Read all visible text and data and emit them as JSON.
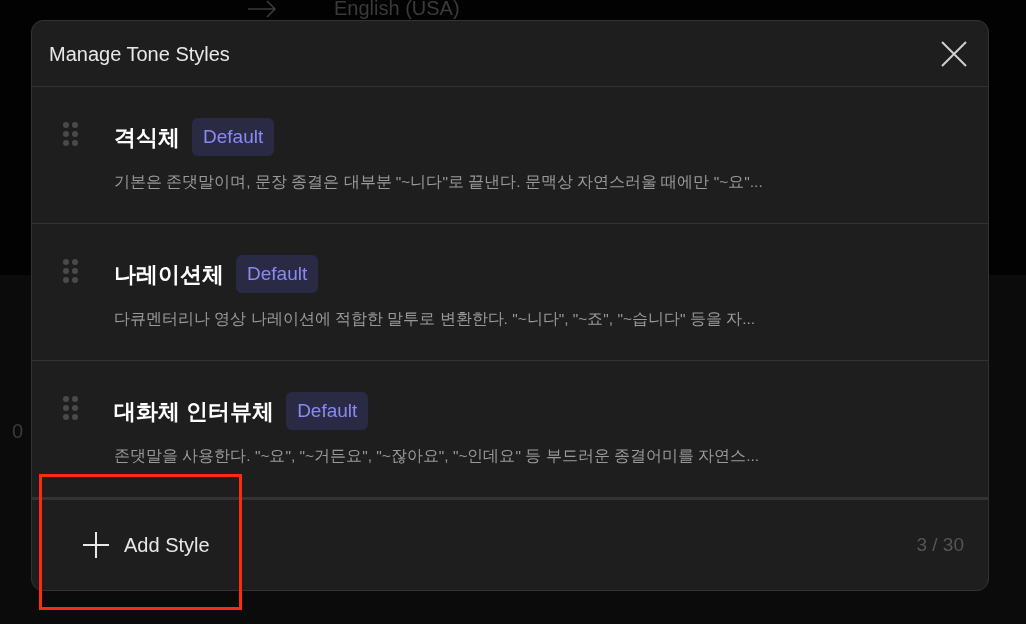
{
  "background": {
    "target_language": "English (USA)",
    "axis_label": "0"
  },
  "dialog": {
    "title": "Manage Tone Styles",
    "styles": [
      {
        "name": "격식체",
        "badge": "Default",
        "description": "기본은 존댓말이며, 문장 종결은 대부분 \"~니다\"로 끝낸다. 문맥상 자연스러울 때에만 \"~요\"..."
      },
      {
        "name": "나레이션체",
        "badge": "Default",
        "description": "다큐멘터리나 영상 나레이션에 적합한 말투로 변환한다. \"~니다\", \"~죠\", \"~습니다\" 등을 자..."
      },
      {
        "name": "대화체 인터뷰체",
        "badge": "Default",
        "description": "존댓말을 사용한다. \"~요\", \"~거든요\", \"~잖아요\", \"~인데요\" 등 부드러운 종결어미를 자연스..."
      }
    ],
    "add_button": "Add Style",
    "count": "3 / 30"
  }
}
